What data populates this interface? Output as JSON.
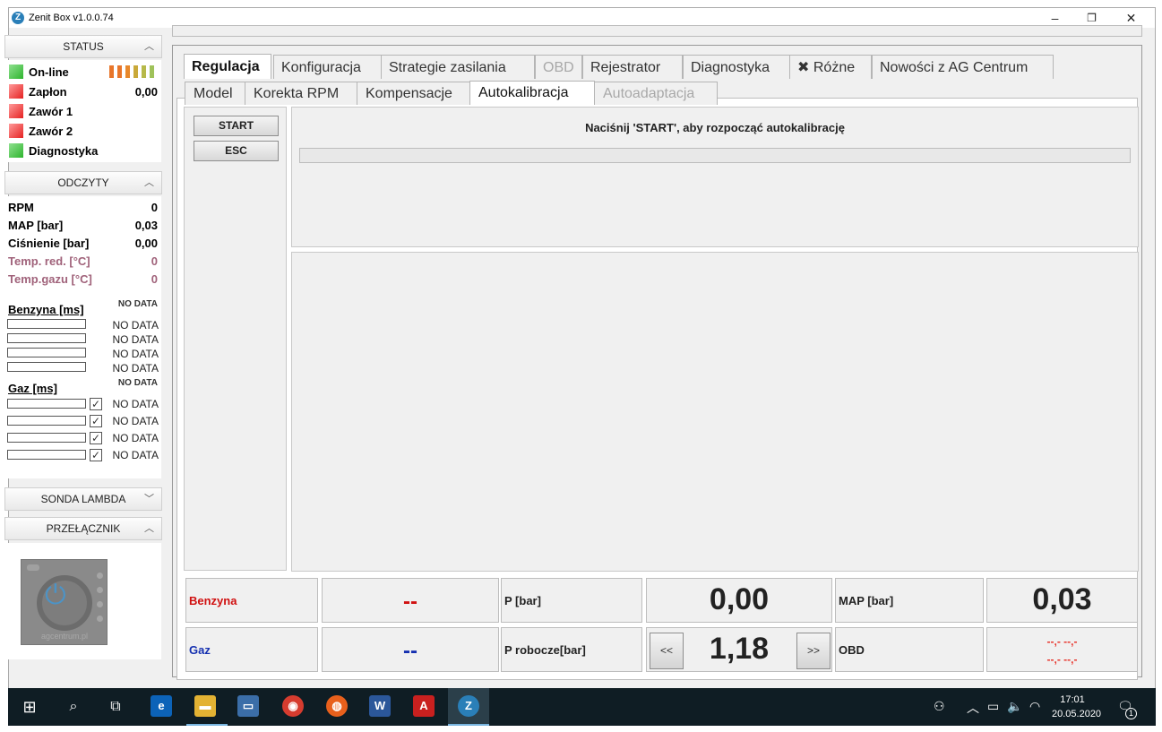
{
  "window": {
    "title": "Zenit Box v1.0.0.74",
    "minimize": "–",
    "restore": "❐",
    "close": "✕"
  },
  "sidebar": {
    "status_header": "STATUS",
    "status_items": [
      {
        "label": "On-line",
        "led": "green",
        "value": ""
      },
      {
        "label": "Zapłon",
        "led": "red",
        "value": "0,00"
      },
      {
        "label": "Zawór 1",
        "led": "red",
        "value": ""
      },
      {
        "label": "Zawór 2",
        "led": "red",
        "value": ""
      },
      {
        "label": "Diagnostyka",
        "led": "green",
        "value": ""
      }
    ],
    "signal_colors": [
      "#e8762b",
      "#e8762b",
      "#e8882b",
      "#c9a93a",
      "#b7b94a",
      "#9fc25a"
    ],
    "readings_header": "ODCZYTY",
    "readings": [
      {
        "label": "RPM",
        "value": "0"
      },
      {
        "label": "MAP [bar]",
        "value": "0,03"
      },
      {
        "label": "Ciśnienie [bar]",
        "value": "0,00"
      },
      {
        "label": "Temp. red. [°C]",
        "value": "0"
      },
      {
        "label": "Temp.gazu [°C]",
        "value": "0"
      }
    ],
    "benzyna_label": "Benzyna [ms]",
    "gaz_label": "Gaz [ms]",
    "nodata_header": "NO DATA",
    "benzyna_rows": [
      "NO DATA",
      "NO DATA",
      "NO DATA",
      "NO DATA"
    ],
    "gaz_rows": [
      "NO DATA",
      "NO DATA",
      "NO DATA",
      "NO DATA"
    ],
    "lambda_header": "SONDA LAMBDA",
    "switch_header": "PRZEŁĄCZNIK",
    "switch_brand": "agcentrum.pl"
  },
  "tabs": [
    "Regulacja",
    "Konfiguracja",
    "Strategie zasilania",
    "OBD",
    "Rejestrator",
    "Diagnostyka",
    "Różne",
    "Nowości z AG Centrum"
  ],
  "subtabs": [
    "Model",
    "Korekta RPM",
    "Kompensacje",
    "Autokalibracja",
    "Autoadaptacja"
  ],
  "autocal": {
    "start": "START",
    "esc": "ESC",
    "message": "Naciśnij 'START', aby rozpocząć autokalibrację"
  },
  "bottom": {
    "benzyna_label": "Benzyna",
    "benzyna_value": "--",
    "gaz_label": "Gaz",
    "gaz_value": "--",
    "p_label": "P [bar]",
    "p_value": "0,00",
    "p_rob_label": "P robocze[bar]",
    "p_rob_value": "1,18",
    "prev": "<<",
    "next": ">>",
    "map_label": "MAP [bar]",
    "map_value": "0,03",
    "obd_label": "OBD",
    "obd_line1": "--,- --,-",
    "obd_line2": "--,- --,-"
  },
  "colors": {
    "benzyna": "#d01010",
    "gaz": "#1530b0",
    "obd": "#e8332a"
  },
  "taskbar": {
    "time": "17:01",
    "date": "20.05.2020",
    "notifications": "1"
  }
}
